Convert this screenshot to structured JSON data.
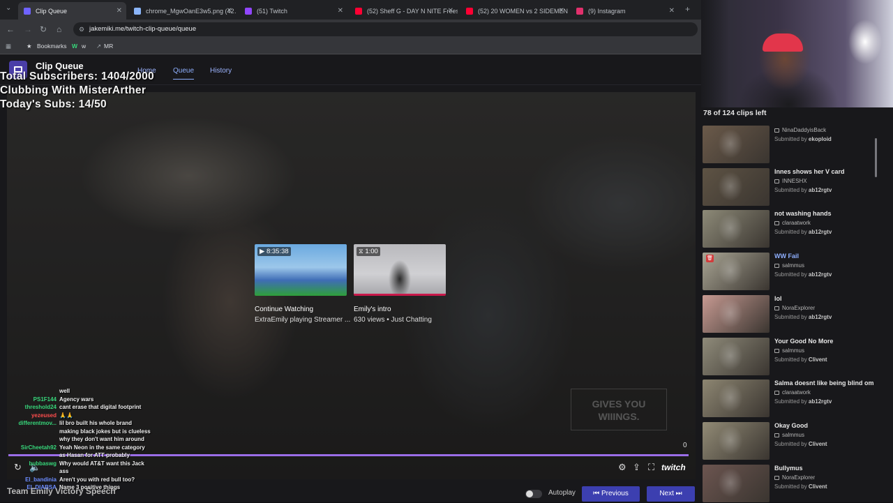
{
  "browser": {
    "tabs": [
      {
        "label": "Clip Queue",
        "color": "#6f63ff"
      },
      {
        "label": "chrome_MgwOanE3w5.png (42…",
        "color": "#8ab4f8"
      },
      {
        "label": "(51) Twitch",
        "color": "#9146ff"
      },
      {
        "label": "(52) Sheff G - DAY N NITE Freest…",
        "color": "#ff0033"
      },
      {
        "label": "(52) 20 WOMEN vs 2 SIDEMEN…",
        "color": "#ff0033"
      },
      {
        "label": "(9) Instagram",
        "color": "#e1306c"
      }
    ],
    "url": "jakemiki.me/twitch-clip-queue/queue",
    "bookmarks": [
      "Bookmarks",
      "w",
      "MR"
    ]
  },
  "app": {
    "title": "Clip Queue",
    "nav": [
      "Home",
      "Queue",
      "History"
    ]
  },
  "overlay": {
    "line1": "Total Subscribers: 1404/2000",
    "line2": "Clubbing With MisterArther",
    "line3": "Today's Subs: 14/50"
  },
  "player": {
    "watermark_line1": "GIVES YOU",
    "watermark_line2": "WIIINGS.",
    "suggestions": [
      {
        "duration": "8:35:38",
        "title": "Continue Watching",
        "subtitle": "ExtraEmily playing Streamer ..."
      },
      {
        "duration": "1:00",
        "title": "Emily's intro",
        "subtitle": "630 views • Just Chatting"
      }
    ],
    "time": "0",
    "brand": "twitch"
  },
  "chat": [
    {
      "user": "",
      "msg": "well",
      "color": "#cccccc"
    },
    {
      "user": "PS1F144",
      "msg": "Agency wars",
      "color": "#37d67a"
    },
    {
      "user": "threshold24",
      "msg": "cant erase that digital footprint",
      "color": "#37d67a"
    },
    {
      "user": "yezeused",
      "msg": "🙏🙏",
      "color": "#ff4d4d"
    },
    {
      "user": "differentmov...",
      "msg": "lil bro built his whole brand making black jokes but is clueless why they don't want him around",
      "color": "#37d67a"
    },
    {
      "user": "SirCheetah92",
      "msg": "Yeah Neon in the same category as Hasan for ATT probably",
      "color": "#37d67a"
    },
    {
      "user": "bubbaswg",
      "msg": "Why would AT&T want this Jack ass",
      "color": "#37d67a"
    },
    {
      "user": "El_bandinia",
      "msg": "Aren't you with red bull too?",
      "color": "#6c8cff"
    },
    {
      "user": "El_DIABSA",
      "msg": "Name 3 positive things",
      "color": "#6c8cff"
    }
  ],
  "footer": {
    "team": "Team Emily Victory Speech",
    "autoplay": "Autoplay",
    "previous": "Previous",
    "next": "Next"
  },
  "queue": {
    "count": "78 of 124 clips left",
    "clips": [
      {
        "title": "",
        "channel": "NinaDaddyisBack",
        "submitter": "ekoploid",
        "thumb": "#6b5a4a"
      },
      {
        "title": "Innes shows her V card",
        "channel": "INNESHX",
        "submitter": "ab12rgtv",
        "thumb": "#5e5344"
      },
      {
        "title": "not washing hands",
        "channel": "claraatwork",
        "submitter": "ab12rgtv",
        "thumb": "#8d8a78"
      },
      {
        "title": "WW Fail",
        "channel": "salmmus",
        "submitter": "ab12rgtv",
        "thumb": "#a9a594"
      },
      {
        "title": "lol",
        "channel": "NoraExplorer",
        "submitter": "ab12rgtv",
        "thumb": "#c79a92"
      },
      {
        "title": "Your Good No More",
        "channel": "salmmus",
        "submitter": "Clivent",
        "thumb": "#8f8b7a"
      },
      {
        "title": "Salma doesnt like being blind om",
        "channel": "claraatwork",
        "submitter": "ab12rgtv",
        "thumb": "#8d8672"
      },
      {
        "title": "Okay Good",
        "channel": "salmmus",
        "submitter": "Clivent",
        "thumb": "#928b76"
      },
      {
        "title": "Bullymus",
        "channel": "NoraExplorer",
        "submitter": "Clivent",
        "thumb": "#6c5550"
      }
    ]
  }
}
